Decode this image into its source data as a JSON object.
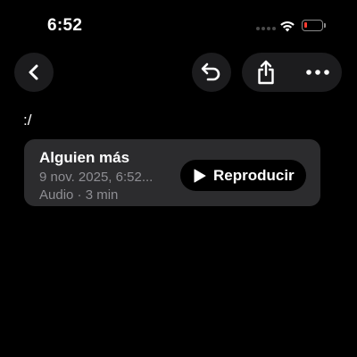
{
  "status_bar": {
    "time": "6:52",
    "battery_level_fraction": 0.1,
    "battery_color": "#ff3b30"
  },
  "toolbar": {
    "back_icon": "chevron-left-icon",
    "reply_icon": "undo-arrow-icon",
    "share_icon": "share-icon",
    "more_icon": "ellipsis-icon"
  },
  "message": {
    "text": ":/"
  },
  "audio_card": {
    "title": "Alguien más",
    "date": "9 nov. 2025, 6:52...",
    "meta": "Audio · 3 min",
    "play_label": "Reproducir",
    "play_icon": "play-icon"
  },
  "colors": {
    "background": "#000000",
    "button_bg": "#1c1c1e",
    "card_bg": "#2c2c2e",
    "secondary_text": "#8e8e93"
  }
}
